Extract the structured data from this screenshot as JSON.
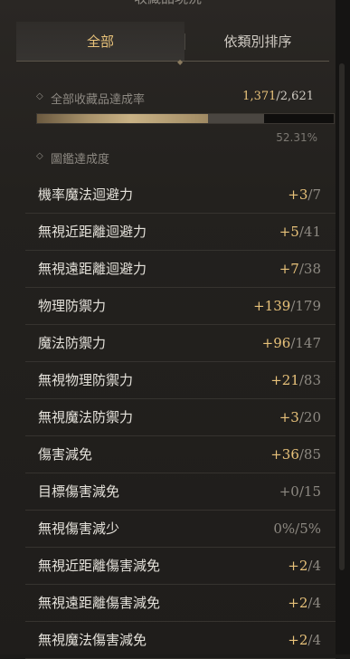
{
  "title": "收藏品現況",
  "tabs": {
    "all": "全部",
    "by_category": "依類別排序"
  },
  "achievement": {
    "label": "全部收藏品達成率",
    "current": "1,371",
    "total": "/2,621",
    "percent_text": "52.31%",
    "progress": 0.5231
  },
  "codex_label": "圖鑑達成度",
  "colors": {
    "accent_gold": "#e8c27a",
    "muted": "#8d8982"
  },
  "stats": [
    {
      "name": "機率魔法迴避力",
      "current": "+3",
      "total": "/7"
    },
    {
      "name": "無視近距離迴避力",
      "current": "+5",
      "total": "/41"
    },
    {
      "name": "無視遠距離迴避力",
      "current": "+7",
      "total": "/38"
    },
    {
      "name": "物理防禦力",
      "current": "+139",
      "total": "/179"
    },
    {
      "name": "魔法防禦力",
      "current": "+96",
      "total": "/147"
    },
    {
      "name": "無視物理防禦力",
      "current": "+21",
      "total": "/83"
    },
    {
      "name": "無視魔法防禦力",
      "current": "+3",
      "total": "/20"
    },
    {
      "name": "傷害減免",
      "current": "+36",
      "total": "/85"
    },
    {
      "name": "目標傷害減免",
      "current": "+0",
      "total": "/15"
    },
    {
      "name": "無視傷害減少",
      "current": "0%",
      "total": "/5%"
    },
    {
      "name": "無視近距離傷害減免",
      "current": "+2",
      "total": "/4"
    },
    {
      "name": "無視遠距離傷害減免",
      "current": "+2",
      "total": "/4"
    },
    {
      "name": "無視魔法傷害減免",
      "current": "+2",
      "total": "/4"
    }
  ]
}
